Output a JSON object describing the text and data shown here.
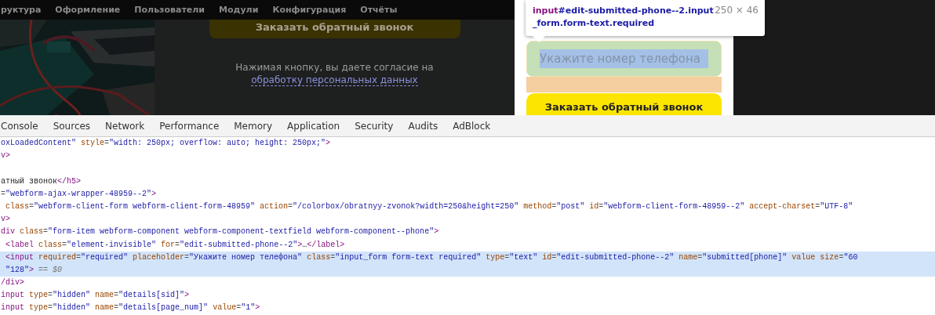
{
  "admin_menu": [
    "руктура",
    "Оформление",
    "Пользователи",
    "Модули",
    "Конфигурация",
    "Отчёты"
  ],
  "page": {
    "dimmed_button": "Заказать обратный звонок",
    "consent_text": "Нажимая кнопку, вы даете согласие на",
    "consent_link": "обработку персональных данных"
  },
  "popup": {
    "phone_field": {
      "placeholder": "Укажите номер телефона"
    },
    "submit_button": "Заказать обратный звонок"
  },
  "inspect_tooltip": {
    "tag": "input",
    "selector": "#edit-submitted-phone--2.input_form.form-text.required",
    "size": "250 × 46"
  },
  "devtools": {
    "tabs": [
      {
        "label": "Console",
        "selected": false
      },
      {
        "label": "Sources",
        "selected": false
      },
      {
        "label": "Network",
        "selected": false
      },
      {
        "label": "Performance",
        "selected": false
      },
      {
        "label": "Memory",
        "selected": false
      },
      {
        "label": "Application",
        "selected": false
      },
      {
        "label": "Security",
        "selected": false
      },
      {
        "label": "Audits",
        "selected": false
      },
      {
        "label": "AdBlock",
        "selected": false
      }
    ],
    "code_lines": [
      {
        "highlighted": false,
        "tokens": [
          {
            "kind": "value",
            "text": "oxLoadedContent\""
          },
          {
            "kind": "attr",
            "text": " style"
          },
          {
            "kind": "punct",
            "text": "="
          },
          {
            "kind": "value",
            "text": "\"width: 250px; overflow: auto; height: 250px;\""
          },
          {
            "kind": "tag",
            "text": ">"
          }
        ]
      },
      {
        "highlighted": false,
        "tokens": [
          {
            "kind": "tag",
            "text": "v>"
          }
        ]
      },
      {
        "highlighted": false,
        "tokens": [
          {
            "kind": "text",
            "text": "атный звонок"
          },
          {
            "kind": "tag",
            "text": "</h5>"
          }
        ]
      },
      {
        "highlighted": false,
        "tokens": [
          {
            "kind": "punct",
            "text": "="
          },
          {
            "kind": "value",
            "text": "\"webform-ajax-wrapper-48959--2\""
          },
          {
            "kind": "tag",
            "text": ">"
          }
        ]
      },
      {
        "highlighted": false,
        "tokens": [
          {
            "kind": "attr",
            "text": " class"
          },
          {
            "kind": "punct",
            "text": "="
          },
          {
            "kind": "value",
            "text": "\"webform-client-form webform-client-form-48959\""
          },
          {
            "kind": "attr",
            "text": " action"
          },
          {
            "kind": "punct",
            "text": "="
          },
          {
            "kind": "value",
            "text": "\"/colorbox/obratnyy-zvonok?width=250&height=250\""
          },
          {
            "kind": "attr",
            "text": " method"
          },
          {
            "kind": "punct",
            "text": "="
          },
          {
            "kind": "value",
            "text": "\"post\""
          },
          {
            "kind": "attr",
            "text": " id"
          },
          {
            "kind": "punct",
            "text": "="
          },
          {
            "kind": "value",
            "text": "\"webform-client-form-48959--2\""
          },
          {
            "kind": "attr",
            "text": " accept-charset"
          },
          {
            "kind": "punct",
            "text": "="
          },
          {
            "kind": "value",
            "text": "\"UTF-8\""
          }
        ]
      },
      {
        "highlighted": false,
        "tokens": [
          {
            "kind": "tag",
            "text": "v>"
          }
        ]
      },
      {
        "highlighted": false,
        "tokens": [
          {
            "kind": "tag",
            "text": "div"
          },
          {
            "kind": "attr",
            "text": " class"
          },
          {
            "kind": "punct",
            "text": "="
          },
          {
            "kind": "value",
            "text": "\"form-item webform-component webform-component-textfield webform-component--phone\""
          },
          {
            "kind": "tag",
            "text": ">"
          }
        ]
      },
      {
        "highlighted": false,
        "tokens": [
          {
            "kind": "tag",
            "text": " <label"
          },
          {
            "kind": "attr",
            "text": " class"
          },
          {
            "kind": "punct",
            "text": "="
          },
          {
            "kind": "value",
            "text": "\"element-invisible\""
          },
          {
            "kind": "attr",
            "text": " for"
          },
          {
            "kind": "punct",
            "text": "="
          },
          {
            "kind": "value",
            "text": "\"edit-submitted-phone--2\""
          },
          {
            "kind": "tag",
            "text": ">"
          },
          {
            "kind": "text",
            "text": "…"
          },
          {
            "kind": "tag",
            "text": "</label>"
          }
        ]
      },
      {
        "highlighted": true,
        "tokens": [
          {
            "kind": "tag",
            "text": " <input"
          },
          {
            "kind": "attr",
            "text": " required"
          },
          {
            "kind": "punct",
            "text": "="
          },
          {
            "kind": "value",
            "text": "\"required\""
          },
          {
            "kind": "attr",
            "text": " placeholder"
          },
          {
            "kind": "punct",
            "text": "="
          },
          {
            "kind": "value",
            "text": "\"Укажите номер телефона\""
          },
          {
            "kind": "attr",
            "text": " class"
          },
          {
            "kind": "punct",
            "text": "="
          },
          {
            "kind": "value",
            "text": "\"input_form form-text required\""
          },
          {
            "kind": "attr",
            "text": " type"
          },
          {
            "kind": "punct",
            "text": "="
          },
          {
            "kind": "value",
            "text": "\"text\""
          },
          {
            "kind": "attr",
            "text": " id"
          },
          {
            "kind": "punct",
            "text": "="
          },
          {
            "kind": "value",
            "text": "\"edit-submitted-phone--2\""
          },
          {
            "kind": "attr",
            "text": " name"
          },
          {
            "kind": "punct",
            "text": "="
          },
          {
            "kind": "value",
            "text": "\"submitted[phone]\""
          },
          {
            "kind": "attr",
            "text": " value size"
          },
          {
            "kind": "punct",
            "text": "="
          },
          {
            "kind": "value",
            "text": "\"60"
          }
        ]
      },
      {
        "highlighted": true,
        "tokens": [
          {
            "kind": "value",
            "text": " \"128\""
          },
          {
            "kind": "tag",
            "text": ">"
          },
          {
            "kind": "console",
            "text": " == $0"
          }
        ]
      },
      {
        "highlighted": false,
        "tokens": [
          {
            "kind": "tag",
            "text": "/div>"
          }
        ]
      },
      {
        "highlighted": false,
        "tokens": [
          {
            "kind": "tag",
            "text": "input"
          },
          {
            "kind": "attr",
            "text": " type"
          },
          {
            "kind": "punct",
            "text": "="
          },
          {
            "kind": "value",
            "text": "\"hidden\""
          },
          {
            "kind": "attr",
            "text": " name"
          },
          {
            "kind": "punct",
            "text": "="
          },
          {
            "kind": "value",
            "text": "\"details[sid]\""
          },
          {
            "kind": "tag",
            "text": ">"
          }
        ]
      },
      {
        "highlighted": false,
        "tokens": [
          {
            "kind": "tag",
            "text": "input"
          },
          {
            "kind": "attr",
            "text": " type"
          },
          {
            "kind": "punct",
            "text": "="
          },
          {
            "kind": "value",
            "text": "\"hidden\""
          },
          {
            "kind": "attr",
            "text": " name"
          },
          {
            "kind": "punct",
            "text": "="
          },
          {
            "kind": "value",
            "text": "\"details[page_num]\""
          },
          {
            "kind": "attr",
            "text": " value"
          },
          {
            "kind": "punct",
            "text": "="
          },
          {
            "kind": "value",
            "text": "\"1\""
          },
          {
            "kind": "tag",
            "text": ">"
          }
        ]
      }
    ]
  }
}
